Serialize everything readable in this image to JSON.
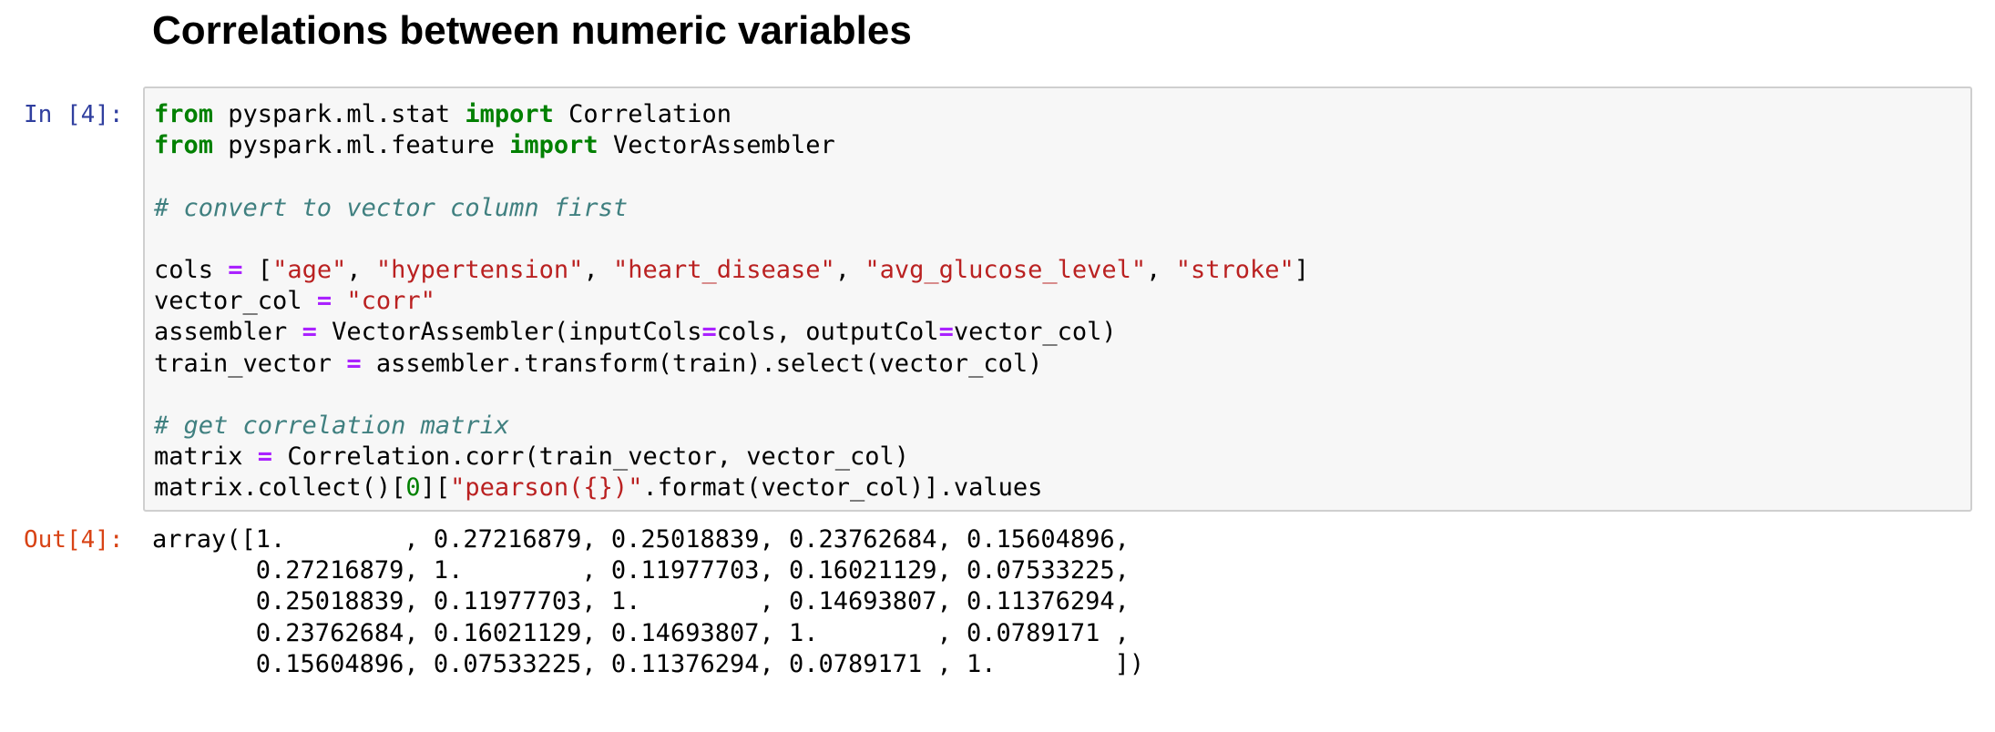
{
  "notebook": {
    "heading": "Correlations between numeric variables",
    "cell": {
      "in_prompt": "In [4]:",
      "out_prompt": "Out[4]:",
      "code": {
        "l1": [
          "from",
          " pyspark.ml.stat ",
          "import",
          " Correlation"
        ],
        "l2": [
          "from",
          " pyspark.ml.feature ",
          "import",
          " VectorAssembler"
        ],
        "l3": "",
        "l4": "# convert to vector column first",
        "l5": "",
        "l6": [
          "cols ",
          "=",
          " [",
          "\"age\"",
          ", ",
          "\"hypertension\"",
          ", ",
          "\"heart_disease\"",
          ", ",
          "\"avg_glucose_level\"",
          ", ",
          "\"stroke\"",
          "]"
        ],
        "l7": [
          "vector_col ",
          "=",
          " ",
          "\"corr\""
        ],
        "l8": [
          "assembler ",
          "=",
          " VectorAssembler(inputCols",
          "=",
          "cols, outputCol",
          "=",
          "vector_col)"
        ],
        "l9": [
          "train_vector ",
          "=",
          " assembler.transform(train).select(vector_col)"
        ],
        "l10": "",
        "l11": "# get correlation matrix",
        "l12": [
          "matrix ",
          "=",
          " Correlation.corr(train_vector, vector_col)"
        ],
        "l13": [
          "matrix.collect()[",
          "0",
          "][",
          "\"pearson({})\"",
          ".format(vector_col)].values"
        ]
      },
      "output_lines": [
        "array([1.        , 0.27216879, 0.25018839, 0.23762684, 0.15604896,",
        "       0.27216879, 1.        , 0.11977703, 0.16021129, 0.07533225,",
        "       0.25018839, 0.11977703, 1.        , 0.14693807, 0.11376294,",
        "       0.23762684, 0.16021129, 0.14693807, 1.        , 0.0789171 ,",
        "       0.15604896, 0.07533225, 0.11376294, 0.0789171 , 1.        ])"
      ]
    }
  },
  "colors": {
    "keyword": "#008000",
    "string": "#ba2121",
    "operator": "#aa22ff",
    "comment": "#408080",
    "in_prompt": "#303f9f",
    "out_prompt": "#d84315",
    "cell_background": "#f7f7f7",
    "cell_border": "#cfcfcf"
  }
}
